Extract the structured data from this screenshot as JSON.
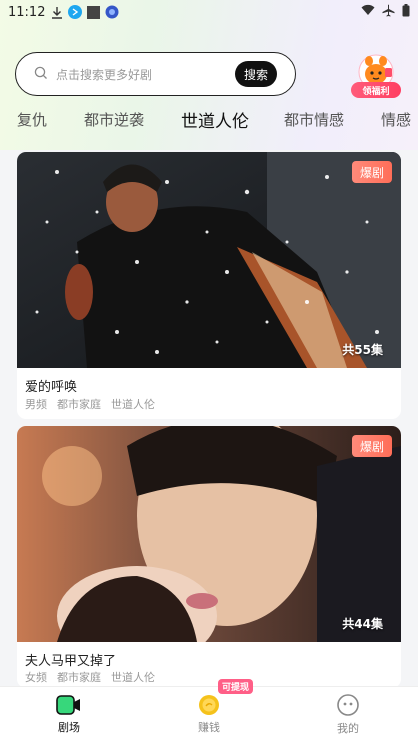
{
  "status_bar": {
    "time": "11:12"
  },
  "search": {
    "placeholder": "点击搜索更多好剧",
    "button_label": "搜索"
  },
  "welfare": {
    "badge_label": "领福利"
  },
  "tabs": [
    {
      "label": "复仇"
    },
    {
      "label": "都市逆袭"
    },
    {
      "label": "世道人伦",
      "active": true
    },
    {
      "label": "都市情感"
    },
    {
      "label": "情感"
    }
  ],
  "dramas": [
    {
      "badge": "爆剧",
      "episodes": "共55集",
      "title": "爱的呼唤",
      "tags": [
        "男频",
        "都市家庭",
        "世道人伦"
      ]
    },
    {
      "badge": "爆剧",
      "episodes": "共44集",
      "title": "夫人马甲又掉了",
      "tags": [
        "女频",
        "都市家庭",
        "世道人伦"
      ]
    }
  ],
  "bottom_nav": [
    {
      "label": "剧场",
      "active": true
    },
    {
      "label": "赚钱",
      "badge": "可提现"
    },
    {
      "label": "我的"
    }
  ],
  "colors": {
    "accent": "#ff6e58",
    "active_tab_icon": "#37d77b",
    "coin": "#f5c21b"
  }
}
